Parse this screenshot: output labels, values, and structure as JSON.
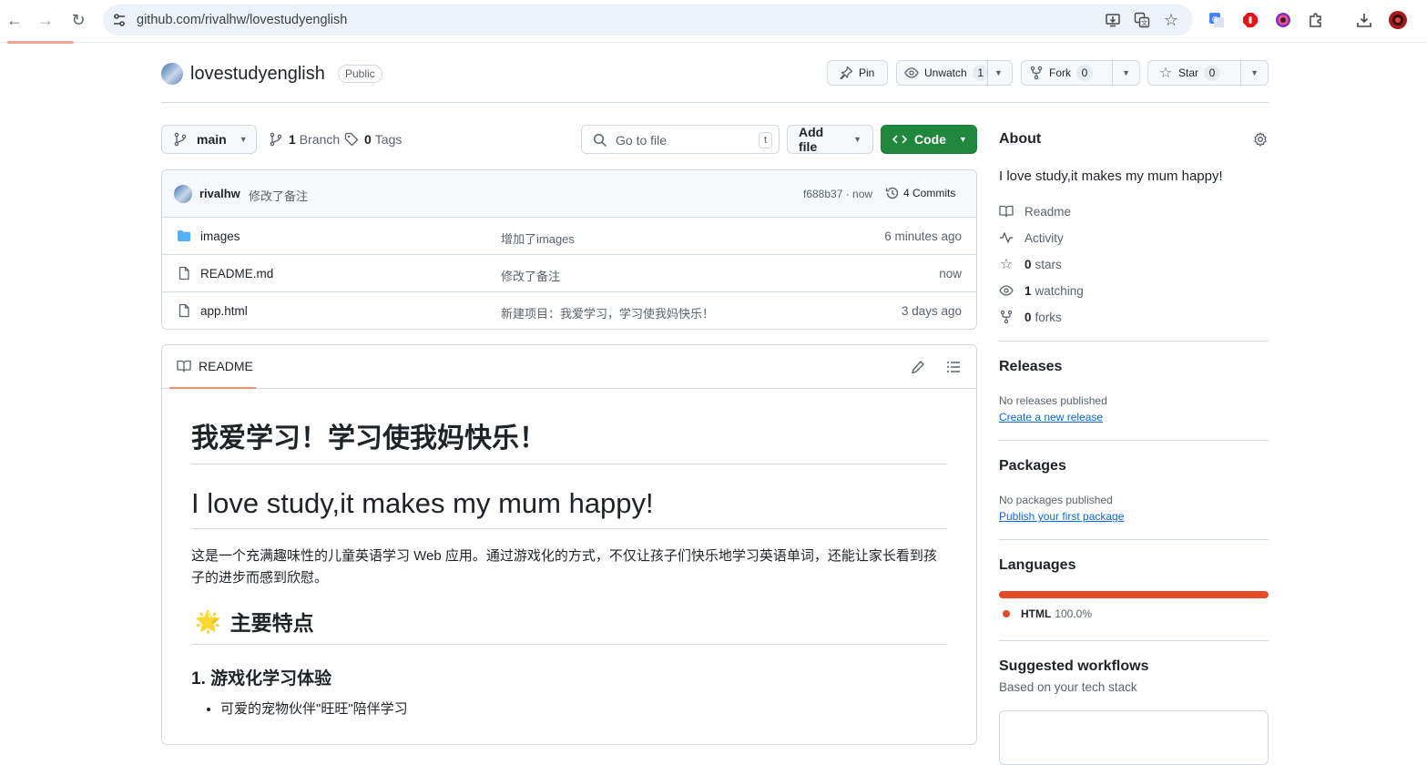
{
  "browser": {
    "url": "github.com/rivalhw/lovestudyenglish"
  },
  "repo": {
    "name": "lovestudyenglish",
    "visibility": "Public",
    "pin_label": "Pin",
    "watch_label": "Unwatch",
    "watch_count": "1",
    "fork_label": "Fork",
    "fork_count": "0",
    "star_label": "Star",
    "star_count": "0"
  },
  "filenav": {
    "branch": "main",
    "branches_count": "1",
    "branches_label": "Branch",
    "tags_count": "0",
    "tags_label": "Tags",
    "search_placeholder": "Go to file",
    "search_shortcut": "t",
    "add_file_label": "Add file",
    "code_label": "Code"
  },
  "latest_commit": {
    "author": "rivalhw",
    "message": "修改了备注",
    "sha_time": "f688b37 · now",
    "commits_label": "4 Commits"
  },
  "files": [
    {
      "type": "folder",
      "name": "images",
      "message": "增加了images",
      "when": "6 minutes ago"
    },
    {
      "type": "file",
      "name": "README.md",
      "message": "修改了备注",
      "when": "now"
    },
    {
      "type": "file",
      "name": "app.html",
      "message": "新建项目：我爱学习，学习使我妈快乐！",
      "when": "3 days ago"
    }
  ],
  "readme": {
    "tab_label": "README",
    "h1_cn": "我爱学习！学习使我妈快乐！",
    "h1_en": "I love study,it makes my mum happy!",
    "intro": "这是一个充满趣味性的儿童英语学习 Web 应用。通过游戏化的方式，不仅让孩子们快乐地学习英语单词，还能让家长看到孩子的进步而感到欣慰。",
    "h2_emoji": "🌟",
    "h2": "主要特点",
    "h3": "1. 游戏化学习体验",
    "list": [
      "可爱的宠物伙伴\"旺旺\"陪伴学习"
    ]
  },
  "about": {
    "title": "About",
    "description": "I love study,it makes my mum happy!",
    "readme_label": "Readme",
    "activity_label": "Activity",
    "stars_count": "0",
    "stars_label": "stars",
    "watching_count": "1",
    "watching_label": "watching",
    "forks_count": "0",
    "forks_label": "forks"
  },
  "releases": {
    "title": "Releases",
    "empty_text": "No releases published",
    "create_link": "Create a new release"
  },
  "packages": {
    "title": "Packages",
    "empty_text": "No packages published",
    "publish_link": "Publish your first package"
  },
  "languages": {
    "title": "Languages",
    "items": [
      {
        "name": "HTML",
        "percent": "100.0%",
        "color": "#e34c26"
      }
    ]
  },
  "workflows": {
    "title": "Suggested workflows",
    "subtitle": "Based on your tech stack"
  }
}
